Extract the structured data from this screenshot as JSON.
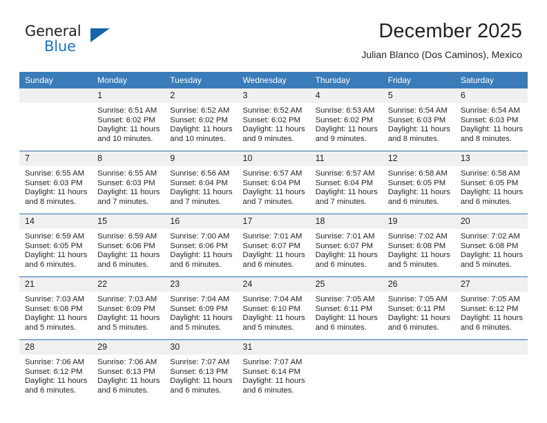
{
  "brand": {
    "name_part1": "General",
    "name_part2": "Blue"
  },
  "header": {
    "month_title": "December 2025",
    "location": "Julian Blanco (Dos Caminos), Mexico"
  },
  "calendar": {
    "weekday_headers": [
      "Sunday",
      "Monday",
      "Tuesday",
      "Wednesday",
      "Thursday",
      "Friday",
      "Saturday"
    ],
    "accent_color": "#3a7cba",
    "grid_line_color": "#2d6ca8",
    "daynum_band_color": "#f0f0f0",
    "weeks": [
      [
        {
          "day": "",
          "empty": true
        },
        {
          "day": "1",
          "sunrise": "Sunrise: 6:51 AM",
          "sunset": "Sunset: 6:02 PM",
          "daylight_line1": "Daylight: 11 hours",
          "daylight_line2": "and 10 minutes."
        },
        {
          "day": "2",
          "sunrise": "Sunrise: 6:52 AM",
          "sunset": "Sunset: 6:02 PM",
          "daylight_line1": "Daylight: 11 hours",
          "daylight_line2": "and 10 minutes."
        },
        {
          "day": "3",
          "sunrise": "Sunrise: 6:52 AM",
          "sunset": "Sunset: 6:02 PM",
          "daylight_line1": "Daylight: 11 hours",
          "daylight_line2": "and 9 minutes."
        },
        {
          "day": "4",
          "sunrise": "Sunrise: 6:53 AM",
          "sunset": "Sunset: 6:02 PM",
          "daylight_line1": "Daylight: 11 hours",
          "daylight_line2": "and 9 minutes."
        },
        {
          "day": "5",
          "sunrise": "Sunrise: 6:54 AM",
          "sunset": "Sunset: 6:03 PM",
          "daylight_line1": "Daylight: 11 hours",
          "daylight_line2": "and 8 minutes."
        },
        {
          "day": "6",
          "sunrise": "Sunrise: 6:54 AM",
          "sunset": "Sunset: 6:03 PM",
          "daylight_line1": "Daylight: 11 hours",
          "daylight_line2": "and 8 minutes."
        }
      ],
      [
        {
          "day": "7",
          "sunrise": "Sunrise: 6:55 AM",
          "sunset": "Sunset: 6:03 PM",
          "daylight_line1": "Daylight: 11 hours",
          "daylight_line2": "and 8 minutes."
        },
        {
          "day": "8",
          "sunrise": "Sunrise: 6:55 AM",
          "sunset": "Sunset: 6:03 PM",
          "daylight_line1": "Daylight: 11 hours",
          "daylight_line2": "and 7 minutes."
        },
        {
          "day": "9",
          "sunrise": "Sunrise: 6:56 AM",
          "sunset": "Sunset: 6:04 PM",
          "daylight_line1": "Daylight: 11 hours",
          "daylight_line2": "and 7 minutes."
        },
        {
          "day": "10",
          "sunrise": "Sunrise: 6:57 AM",
          "sunset": "Sunset: 6:04 PM",
          "daylight_line1": "Daylight: 11 hours",
          "daylight_line2": "and 7 minutes."
        },
        {
          "day": "11",
          "sunrise": "Sunrise: 6:57 AM",
          "sunset": "Sunset: 6:04 PM",
          "daylight_line1": "Daylight: 11 hours",
          "daylight_line2": "and 7 minutes."
        },
        {
          "day": "12",
          "sunrise": "Sunrise: 6:58 AM",
          "sunset": "Sunset: 6:05 PM",
          "daylight_line1": "Daylight: 11 hours",
          "daylight_line2": "and 6 minutes."
        },
        {
          "day": "13",
          "sunrise": "Sunrise: 6:58 AM",
          "sunset": "Sunset: 6:05 PM",
          "daylight_line1": "Daylight: 11 hours",
          "daylight_line2": "and 6 minutes."
        }
      ],
      [
        {
          "day": "14",
          "sunrise": "Sunrise: 6:59 AM",
          "sunset": "Sunset: 6:05 PM",
          "daylight_line1": "Daylight: 11 hours",
          "daylight_line2": "and 6 minutes."
        },
        {
          "day": "15",
          "sunrise": "Sunrise: 6:59 AM",
          "sunset": "Sunset: 6:06 PM",
          "daylight_line1": "Daylight: 11 hours",
          "daylight_line2": "and 6 minutes."
        },
        {
          "day": "16",
          "sunrise": "Sunrise: 7:00 AM",
          "sunset": "Sunset: 6:06 PM",
          "daylight_line1": "Daylight: 11 hours",
          "daylight_line2": "and 6 minutes."
        },
        {
          "day": "17",
          "sunrise": "Sunrise: 7:01 AM",
          "sunset": "Sunset: 6:07 PM",
          "daylight_line1": "Daylight: 11 hours",
          "daylight_line2": "and 6 minutes."
        },
        {
          "day": "18",
          "sunrise": "Sunrise: 7:01 AM",
          "sunset": "Sunset: 6:07 PM",
          "daylight_line1": "Daylight: 11 hours",
          "daylight_line2": "and 6 minutes."
        },
        {
          "day": "19",
          "sunrise": "Sunrise: 7:02 AM",
          "sunset": "Sunset: 6:08 PM",
          "daylight_line1": "Daylight: 11 hours",
          "daylight_line2": "and 5 minutes."
        },
        {
          "day": "20",
          "sunrise": "Sunrise: 7:02 AM",
          "sunset": "Sunset: 6:08 PM",
          "daylight_line1": "Daylight: 11 hours",
          "daylight_line2": "and 5 minutes."
        }
      ],
      [
        {
          "day": "21",
          "sunrise": "Sunrise: 7:03 AM",
          "sunset": "Sunset: 6:08 PM",
          "daylight_line1": "Daylight: 11 hours",
          "daylight_line2": "and 5 minutes."
        },
        {
          "day": "22",
          "sunrise": "Sunrise: 7:03 AM",
          "sunset": "Sunset: 6:09 PM",
          "daylight_line1": "Daylight: 11 hours",
          "daylight_line2": "and 5 minutes."
        },
        {
          "day": "23",
          "sunrise": "Sunrise: 7:04 AM",
          "sunset": "Sunset: 6:09 PM",
          "daylight_line1": "Daylight: 11 hours",
          "daylight_line2": "and 5 minutes."
        },
        {
          "day": "24",
          "sunrise": "Sunrise: 7:04 AM",
          "sunset": "Sunset: 6:10 PM",
          "daylight_line1": "Daylight: 11 hours",
          "daylight_line2": "and 5 minutes."
        },
        {
          "day": "25",
          "sunrise": "Sunrise: 7:05 AM",
          "sunset": "Sunset: 6:11 PM",
          "daylight_line1": "Daylight: 11 hours",
          "daylight_line2": "and 6 minutes."
        },
        {
          "day": "26",
          "sunrise": "Sunrise: 7:05 AM",
          "sunset": "Sunset: 6:11 PM",
          "daylight_line1": "Daylight: 11 hours",
          "daylight_line2": "and 6 minutes."
        },
        {
          "day": "27",
          "sunrise": "Sunrise: 7:05 AM",
          "sunset": "Sunset: 6:12 PM",
          "daylight_line1": "Daylight: 11 hours",
          "daylight_line2": "and 6 minutes."
        }
      ],
      [
        {
          "day": "28",
          "sunrise": "Sunrise: 7:06 AM",
          "sunset": "Sunset: 6:12 PM",
          "daylight_line1": "Daylight: 11 hours",
          "daylight_line2": "and 6 minutes."
        },
        {
          "day": "29",
          "sunrise": "Sunrise: 7:06 AM",
          "sunset": "Sunset: 6:13 PM",
          "daylight_line1": "Daylight: 11 hours",
          "daylight_line2": "and 6 minutes."
        },
        {
          "day": "30",
          "sunrise": "Sunrise: 7:07 AM",
          "sunset": "Sunset: 6:13 PM",
          "daylight_line1": "Daylight: 11 hours",
          "daylight_line2": "and 6 minutes."
        },
        {
          "day": "31",
          "sunrise": "Sunrise: 7:07 AM",
          "sunset": "Sunset: 6:14 PM",
          "daylight_line1": "Daylight: 11 hours",
          "daylight_line2": "and 6 minutes."
        },
        {
          "day": "",
          "empty": true
        },
        {
          "day": "",
          "empty": true
        },
        {
          "day": "",
          "empty": true
        }
      ]
    ]
  }
}
